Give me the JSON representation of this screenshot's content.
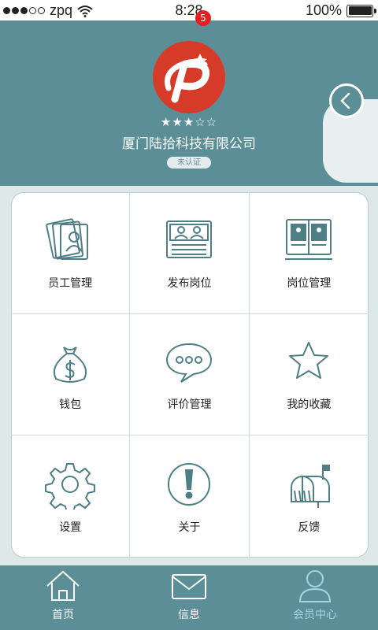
{
  "status_bar": {
    "carrier": "zpq",
    "time": "8:28",
    "battery": "100%",
    "battery_level": 1.0,
    "signal_bars": 3,
    "signal_total": 5
  },
  "header": {
    "rating_stars": "★★★☆☆",
    "company_name": "厦门陆拾科技有限公司",
    "verification_badge": "未认证"
  },
  "grid": {
    "items": [
      {
        "label": "员工管理",
        "icon": "employee-cards-icon"
      },
      {
        "label": "发布岗位",
        "icon": "publish-job-icon"
      },
      {
        "label": "岗位管理",
        "icon": "job-board-icon"
      },
      {
        "label": "钱包",
        "icon": "money-bag-icon"
      },
      {
        "label": "评价管理",
        "icon": "chat-bubble-icon"
      },
      {
        "label": "我的收藏",
        "icon": "star-icon"
      },
      {
        "label": "设置",
        "icon": "gear-icon"
      },
      {
        "label": "关于",
        "icon": "info-exclamation-icon"
      },
      {
        "label": "反馈",
        "icon": "mailbox-icon"
      }
    ]
  },
  "tabbar": {
    "tabs": [
      {
        "label": "首页",
        "icon": "home-icon"
      },
      {
        "label": "信息",
        "icon": "mail-icon",
        "badge": "5"
      },
      {
        "label": "会员中心",
        "icon": "user-icon"
      }
    ],
    "active_tab": "会员中心"
  },
  "colors": {
    "primary": "#5b8e96",
    "icon_stroke": "#4f7f86",
    "logo_red": "#d63b2a",
    "badge_red": "#e02222",
    "active_tab": "#9fd6e6"
  }
}
